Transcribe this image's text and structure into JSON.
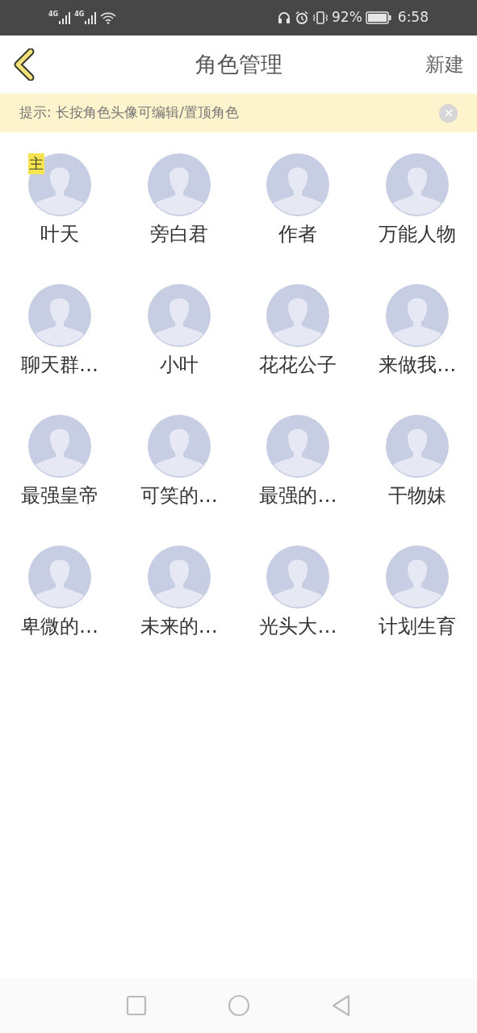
{
  "status_bar": {
    "signals": [
      {
        "label": "4G"
      },
      {
        "label": "4G"
      }
    ],
    "battery": "92%",
    "time": "6:58"
  },
  "header": {
    "title": "角色管理",
    "action": "新建"
  },
  "tip": {
    "text": "提示: 长按角色头像可编辑/置顶角色"
  },
  "roles": [
    {
      "name": "叶天",
      "badge": "主"
    },
    {
      "name": "旁白君"
    },
    {
      "name": "作者"
    },
    {
      "name": "万能人物"
    },
    {
      "name": "聊天群…"
    },
    {
      "name": "小叶"
    },
    {
      "name": "花花公子"
    },
    {
      "name": "来做我…"
    },
    {
      "name": "最强皇帝"
    },
    {
      "name": "可笑的…"
    },
    {
      "name": "最强的…"
    },
    {
      "name": "干物妹"
    },
    {
      "name": "卑微的…"
    },
    {
      "name": "未来的…"
    },
    {
      "name": "光头大…"
    },
    {
      "name": "计划生育"
    }
  ]
}
